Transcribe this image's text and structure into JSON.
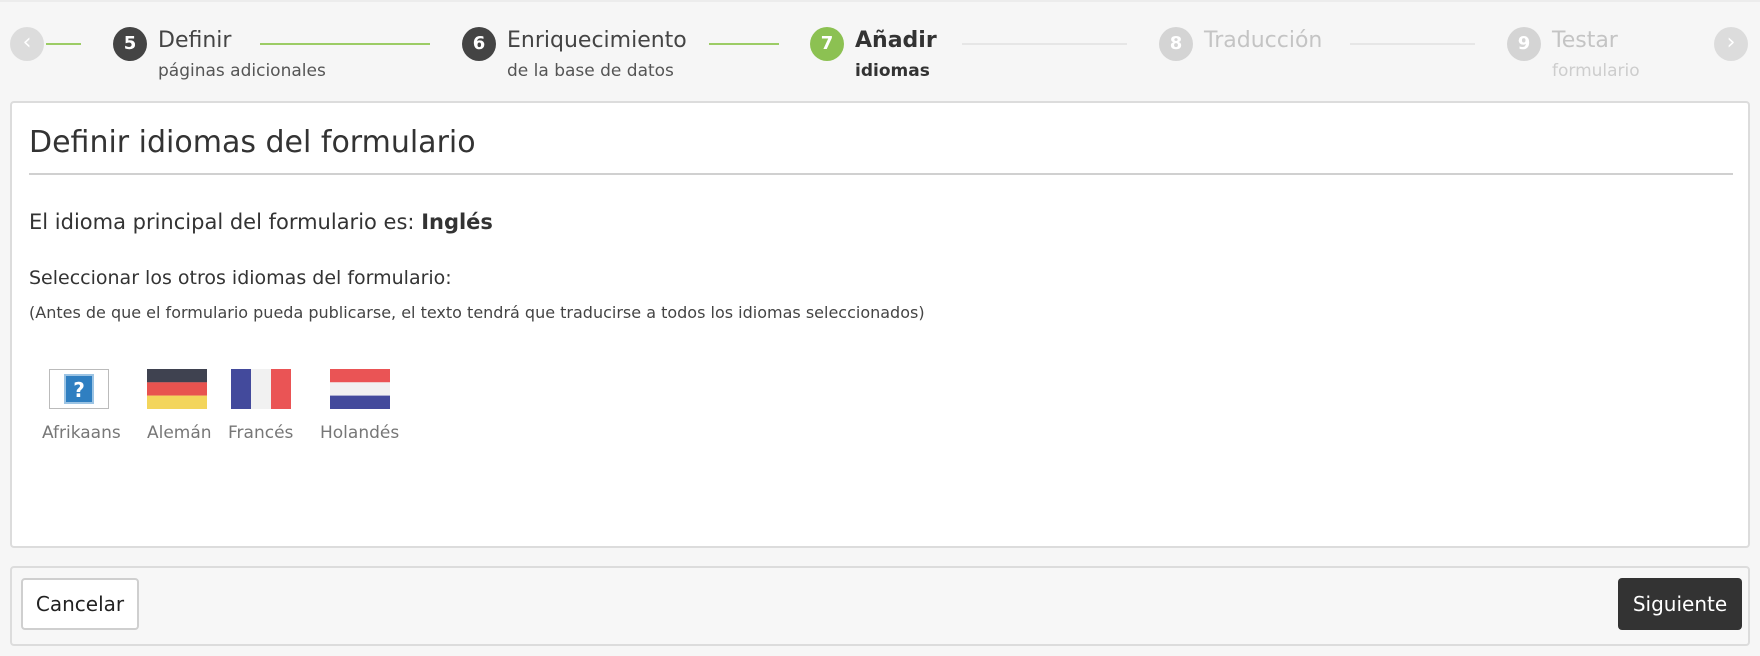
{
  "stepper": {
    "prev_icon": "chevron-left-icon",
    "next_icon": "chevron-right-icon",
    "steps": [
      {
        "num": "5",
        "title": "Definir",
        "sub": "páginas adicionales",
        "state": "done"
      },
      {
        "num": "6",
        "title": "Enriquecimiento",
        "sub": "de la base de datos",
        "state": "done"
      },
      {
        "num": "7",
        "title": "Añadir",
        "sub": "idiomas",
        "state": "active"
      },
      {
        "num": "8",
        "title": "Traducción",
        "sub": "",
        "state": "future"
      },
      {
        "num": "9",
        "title": "Testar",
        "sub": "formulario",
        "state": "future"
      }
    ],
    "colors": {
      "done": "#444444",
      "active": "#8cc152",
      "future": "#d4d4d4"
    }
  },
  "panel": {
    "title": "Definir idiomas del formulario",
    "main_language_prefix": "El idioma principal del formulario es:",
    "main_language": "Inglés",
    "select_label": "Seleccionar los otros idiomas del formulario:",
    "select_note": "(Antes de que el formulario pueda publicarse, el texto tendrá que traducirse a todos los idiomas seleccionados)",
    "languages": [
      {
        "name": "Afrikaans",
        "flag": "unknown-flag-icon"
      },
      {
        "name": "Alemán",
        "flag": "germany-flag-icon"
      },
      {
        "name": "Francés",
        "flag": "france-flag-icon"
      },
      {
        "name": "Holandés",
        "flag": "netherlands-flag-icon"
      }
    ]
  },
  "footer": {
    "cancel_label": "Cancelar",
    "next_label": "Siguiente"
  }
}
